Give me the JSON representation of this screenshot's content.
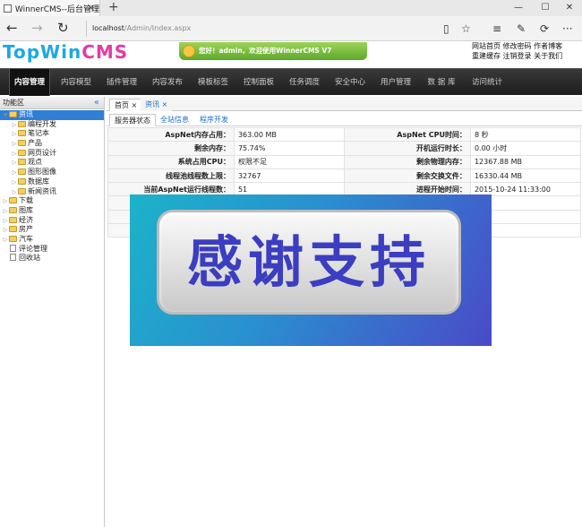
{
  "browser": {
    "tab_title": "WinnerCMS--后台管理",
    "address_host": "localhost",
    "address_path": "/Admin/Index.aspx"
  },
  "header": {
    "logo_part1": "TopWin",
    "logo_part2": "CMS",
    "welcome": "您好！admin，欢迎使用WinnerCMS V7",
    "links_row1": [
      "网站首页",
      "修改密码",
      "作者博客"
    ],
    "links_row2": [
      "重建缓存",
      "注销登录",
      "关于我们"
    ]
  },
  "menu": [
    "内容管理",
    "内容模型",
    "插件管理",
    "内容发布",
    "模板标签",
    "控制面板",
    "任务调度",
    "安全中心",
    "用户管理",
    "数 据 库",
    "访问统计"
  ],
  "leftpanel": {
    "title": "功能区",
    "collapse": "«",
    "tree": [
      {
        "label": "资讯",
        "level": 0,
        "type": "folder",
        "expanded": true,
        "selected": true
      },
      {
        "label": "编程开发",
        "level": 1,
        "type": "folder"
      },
      {
        "label": "笔记本",
        "level": 1,
        "type": "folder"
      },
      {
        "label": "产品",
        "level": 1,
        "type": "folder"
      },
      {
        "label": "网页设计",
        "level": 1,
        "type": "folder"
      },
      {
        "label": "观点",
        "level": 1,
        "type": "folder"
      },
      {
        "label": "图形图像",
        "level": 1,
        "type": "folder"
      },
      {
        "label": "数据库",
        "level": 1,
        "type": "folder"
      },
      {
        "label": "新闻资讯",
        "level": 1,
        "type": "folder"
      },
      {
        "label": "下载",
        "level": 0,
        "type": "folder"
      },
      {
        "label": "图库",
        "level": 0,
        "type": "folder"
      },
      {
        "label": "经济",
        "level": 0,
        "type": "folder"
      },
      {
        "label": "房产",
        "level": 0,
        "type": "folder"
      },
      {
        "label": "汽车",
        "level": 0,
        "type": "folder"
      },
      {
        "label": "评论管理",
        "level": 0,
        "type": "doc"
      },
      {
        "label": "回收站",
        "level": 0,
        "type": "doc"
      }
    ]
  },
  "content": {
    "tabs": [
      {
        "label": "首页 ×"
      },
      {
        "label": "资讯 ×"
      }
    ],
    "subtabs": [
      "服务器状态",
      "全站信息",
      "程序开发"
    ],
    "stats": [
      [
        "AspNet内存占用：",
        "363.00 MB",
        "AspNet CPU时间：",
        "8 秒"
      ],
      [
        "剩余内存：",
        "75.74%",
        "开机运行时长：",
        "0.00 小时"
      ],
      [
        "系统占用CPU：",
        "权限不足",
        "剩余物理内存：",
        "12367.88 MB"
      ],
      [
        "线程池线程数上限：",
        "32767",
        "剩余交换文件：",
        "16330.44 MB"
      ],
      [
        "当前AspNet运行线程数：",
        "51",
        "进程开始时间：",
        "2015-10-24 11:33:00"
      ],
      [
        "",
        "",
        "",
        ""
      ],
      [
        "",
        "",
        "",
        ""
      ],
      [
        "",
        "",
        "",
        ""
      ]
    ]
  },
  "overlay": {
    "text": "感谢支持"
  }
}
